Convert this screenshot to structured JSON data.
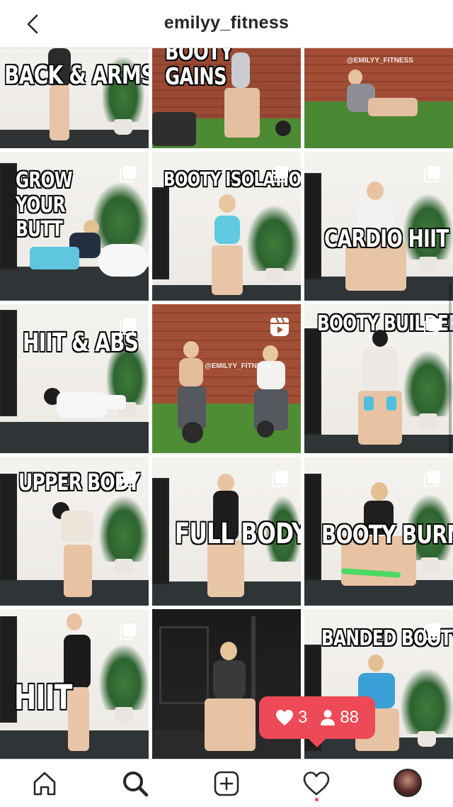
{
  "header": {
    "title": "emilyy_fitness",
    "back_icon": "chevron-left-icon"
  },
  "tiles": [
    {
      "caption": "BACK & ARMS",
      "badge": "",
      "watermark": ""
    },
    {
      "caption": "BOOTY GAINS",
      "badge": "",
      "watermark": ""
    },
    {
      "caption": "",
      "badge": "",
      "watermark": "@EMILYY_FITNESS"
    },
    {
      "caption": "GROW YOUR BUTT",
      "badge": "carousel-icon",
      "watermark": ""
    },
    {
      "caption": "BOOTY ISOLATION",
      "badge": "carousel-icon",
      "watermark": ""
    },
    {
      "caption": "CARDIO HIIT",
      "badge": "carousel-icon",
      "watermark": ""
    },
    {
      "caption": "HIIT & ABS",
      "badge": "carousel-icon",
      "watermark": ""
    },
    {
      "caption": "",
      "badge": "reels-icon",
      "watermark": "@EMILYY_FITNESS"
    },
    {
      "caption": "BOOTY BUILDER",
      "badge": "carousel-icon",
      "watermark": ""
    },
    {
      "caption": "UPPER BODY",
      "badge": "carousel-icon",
      "watermark": ""
    },
    {
      "caption": "FULL BODY",
      "badge": "carousel-icon",
      "watermark": ""
    },
    {
      "caption": "BOOTY BURN",
      "badge": "carousel-icon",
      "watermark": ""
    },
    {
      "caption": "HIIT",
      "badge": "carousel-icon",
      "watermark": ""
    },
    {
      "caption": "",
      "badge": "",
      "watermark": ""
    },
    {
      "caption": "BANDED BOOTY",
      "badge": "carousel-icon",
      "watermark": ""
    }
  ],
  "notification": {
    "likes": "3",
    "followers": "88",
    "like_icon": "heart-icon",
    "follower_icon": "person-icon"
  },
  "nav": {
    "items": [
      "home-icon",
      "search-icon",
      "add-post-icon",
      "activity-heart-icon",
      "profile-avatar"
    ]
  },
  "colors": {
    "accent": "#ed4956",
    "text": "#262626",
    "border": "#dbdbdb"
  }
}
